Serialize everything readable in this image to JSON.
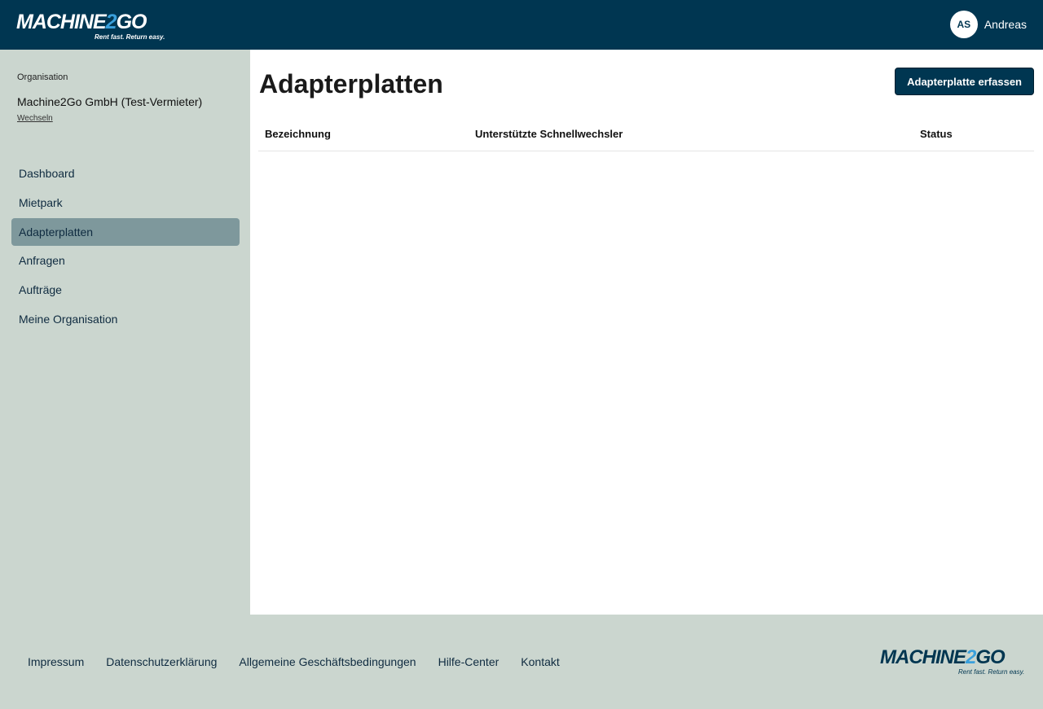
{
  "header": {
    "logo_text": "MACHINE2GO",
    "logo_main": "MACHINE",
    "logo_two": "2",
    "logo_end": "GO",
    "logo_tagline": "Rent fast. Return easy.",
    "user_initials": "AS",
    "user_name": "Andreas"
  },
  "sidebar": {
    "org_label": "Organisation",
    "org_name": "Machine2Go GmbH (Test-Vermieter)",
    "switch_label": "Wechseln",
    "items": [
      {
        "label": "Dashboard"
      },
      {
        "label": "Mietpark"
      },
      {
        "label": "Adapterplatten"
      },
      {
        "label": "Anfragen"
      },
      {
        "label": "Aufträge"
      },
      {
        "label": "Meine Organisation"
      }
    ]
  },
  "main": {
    "title": "Adapterplatten",
    "add_button": "Adapterplatte erfassen",
    "columns": [
      "Bezeichnung",
      "Unterstützte Schnellwechsler",
      "Status"
    ]
  },
  "footer": {
    "links": [
      "Impressum",
      "Datenschutzerklärung",
      "Allgemeine Geschäftsbedingungen",
      "Hilfe-Center",
      "Kontakt"
    ]
  }
}
